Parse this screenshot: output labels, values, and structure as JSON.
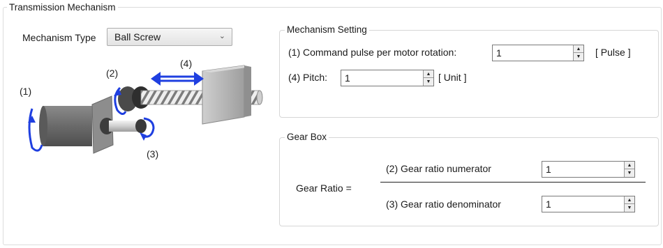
{
  "transmission": {
    "title": "Transmission Mechanism",
    "mechanism_type_label": "Mechanism Type",
    "mechanism_type_value": "Ball Screw",
    "diagram_labels": {
      "l1": "(1)",
      "l2": "(2)",
      "l3": "(3)",
      "l4": "(4)"
    }
  },
  "mechanism_setting": {
    "title": "Mechanism Setting",
    "command_pulse_label": "(1) Command pulse per motor rotation:",
    "command_pulse_value": "1",
    "command_pulse_unit": "[ Pulse ]",
    "pitch_label": "(4) Pitch:",
    "pitch_value": "1",
    "pitch_unit": "[ Unit ]"
  },
  "gear_box": {
    "title": "Gear Box",
    "gear_ratio_label": "Gear Ratio =",
    "numerator_label": "(2) Gear ratio numerator",
    "numerator_value": "1",
    "denominator_label": "(3) Gear ratio denominator",
    "denominator_value": "1"
  },
  "colors": {
    "arrow_blue": "#1f3fe0",
    "motor_grey": "#6f6f6f",
    "block_grey": "#b5b5b5"
  }
}
